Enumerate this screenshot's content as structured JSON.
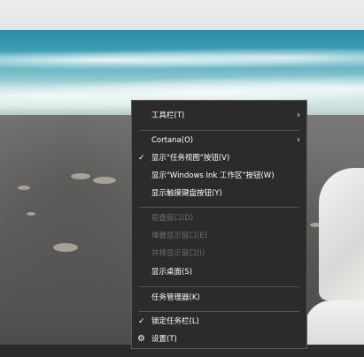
{
  "menu": {
    "toolbar": "工具栏(T)",
    "cortana": "Cortana(O)",
    "show_taskview": "显示\"任务视图\"按钮(V)",
    "show_ink": "显示\"Windows Ink 工作区\"按钮(W)",
    "show_keyboard": "显示触摸键盘按钮(Y)",
    "cascade": "层叠窗口(D)",
    "stack": "堆叠显示窗口(E)",
    "side_by_side": "并排显示窗口(I)",
    "show_desktop": "显示桌面(S)",
    "task_manager": "任务管理器(K)",
    "lock_taskbar": "锁定任务栏(L)",
    "settings": "设置(T)"
  },
  "icons": {
    "check": "checkmark-icon",
    "submenu": "chevron-right-icon",
    "settings": "gear-icon"
  },
  "colors": {
    "menu_bg": "#2b2b2b",
    "menu_text": "#ffffff",
    "disabled_text": "#6d6d6d",
    "separator": "#545454"
  }
}
